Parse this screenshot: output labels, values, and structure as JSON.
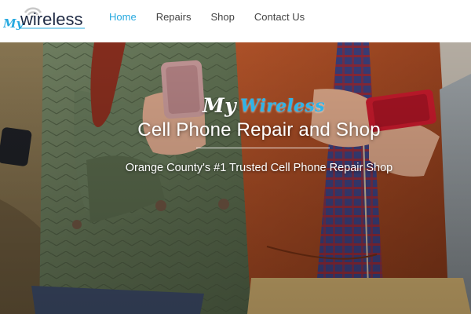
{
  "header": {
    "logo": {
      "my": "My",
      "wireless": "wireless"
    },
    "nav": [
      {
        "label": "Home",
        "active": true
      },
      {
        "label": "Repairs",
        "active": false
      },
      {
        "label": "Shop",
        "active": false
      },
      {
        "label": "Contact Us",
        "active": false
      }
    ]
  },
  "hero": {
    "brand_my": "My",
    "brand_wireless": "Wireless",
    "title": "Cell Phone Repair and Shop",
    "subtitle": "Orange County's #1 Trusted Cell Phone Repair Shop"
  },
  "colors": {
    "accent": "#27a9df",
    "nav_text": "#444444"
  }
}
